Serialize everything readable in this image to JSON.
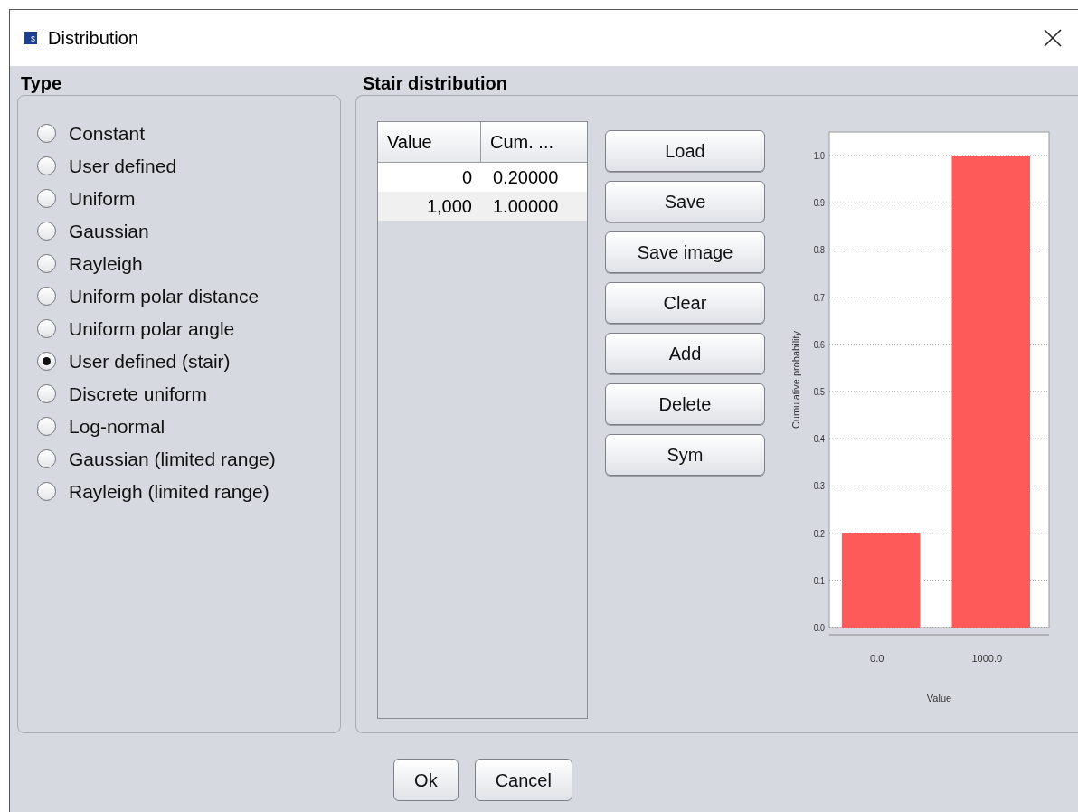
{
  "window": {
    "title": "Distribution",
    "app_icon_letter": "s"
  },
  "type_panel": {
    "title": "Type",
    "options": [
      {
        "label": "Constant",
        "selected": false
      },
      {
        "label": "User defined",
        "selected": false
      },
      {
        "label": "Uniform",
        "selected": false
      },
      {
        "label": "Gaussian",
        "selected": false
      },
      {
        "label": "Rayleigh",
        "selected": false
      },
      {
        "label": "Uniform polar distance",
        "selected": false
      },
      {
        "label": "Uniform polar angle",
        "selected": false
      },
      {
        "label": "User defined (stair)",
        "selected": true
      },
      {
        "label": "Discrete uniform",
        "selected": false
      },
      {
        "label": "Log-normal",
        "selected": false
      },
      {
        "label": "Gaussian (limited range)",
        "selected": false
      },
      {
        "label": "Rayleigh (limited range)",
        "selected": false
      }
    ]
  },
  "stair_panel": {
    "title": "Stair distribution",
    "table": {
      "columns": [
        "Value",
        "Cum. ..."
      ],
      "rows": [
        [
          "0",
          "0.20000"
        ],
        [
          "1,000",
          "1.00000"
        ]
      ]
    },
    "buttons": [
      "Load",
      "Save",
      "Save image",
      "Clear",
      "Add",
      "Delete",
      "Sym"
    ],
    "chart_data": {
      "type": "bar",
      "xlabel": "Value",
      "ylabel": "Cumulative probability",
      "categories": [
        "0.0",
        "1000.0"
      ],
      "grid": true,
      "series": [
        {
          "color": "#ff5a5a",
          "values": [
            0.2,
            1.0
          ]
        }
      ],
      "ylim": [
        0,
        1.05
      ],
      "yticks": [
        {
          "value": 0,
          "label": "0.0"
        },
        {
          "value": 0.1,
          "label": "0.1"
        },
        {
          "value": 0.2,
          "label": "0.2"
        },
        {
          "value": 0.3,
          "label": "0.3"
        },
        {
          "value": 0.4,
          "label": "0.4"
        },
        {
          "value": 0.5,
          "label": "0.5"
        },
        {
          "value": 0.6,
          "label": "0.6"
        },
        {
          "value": 0.7,
          "label": "0.7"
        },
        {
          "value": 0.8,
          "label": "0.8"
        },
        {
          "value": 0.9,
          "label": "0.9"
        },
        {
          "value": 1.0,
          "label": "1.0"
        }
      ]
    }
  },
  "footer_buttons": [
    "Ok",
    "Cancel"
  ]
}
